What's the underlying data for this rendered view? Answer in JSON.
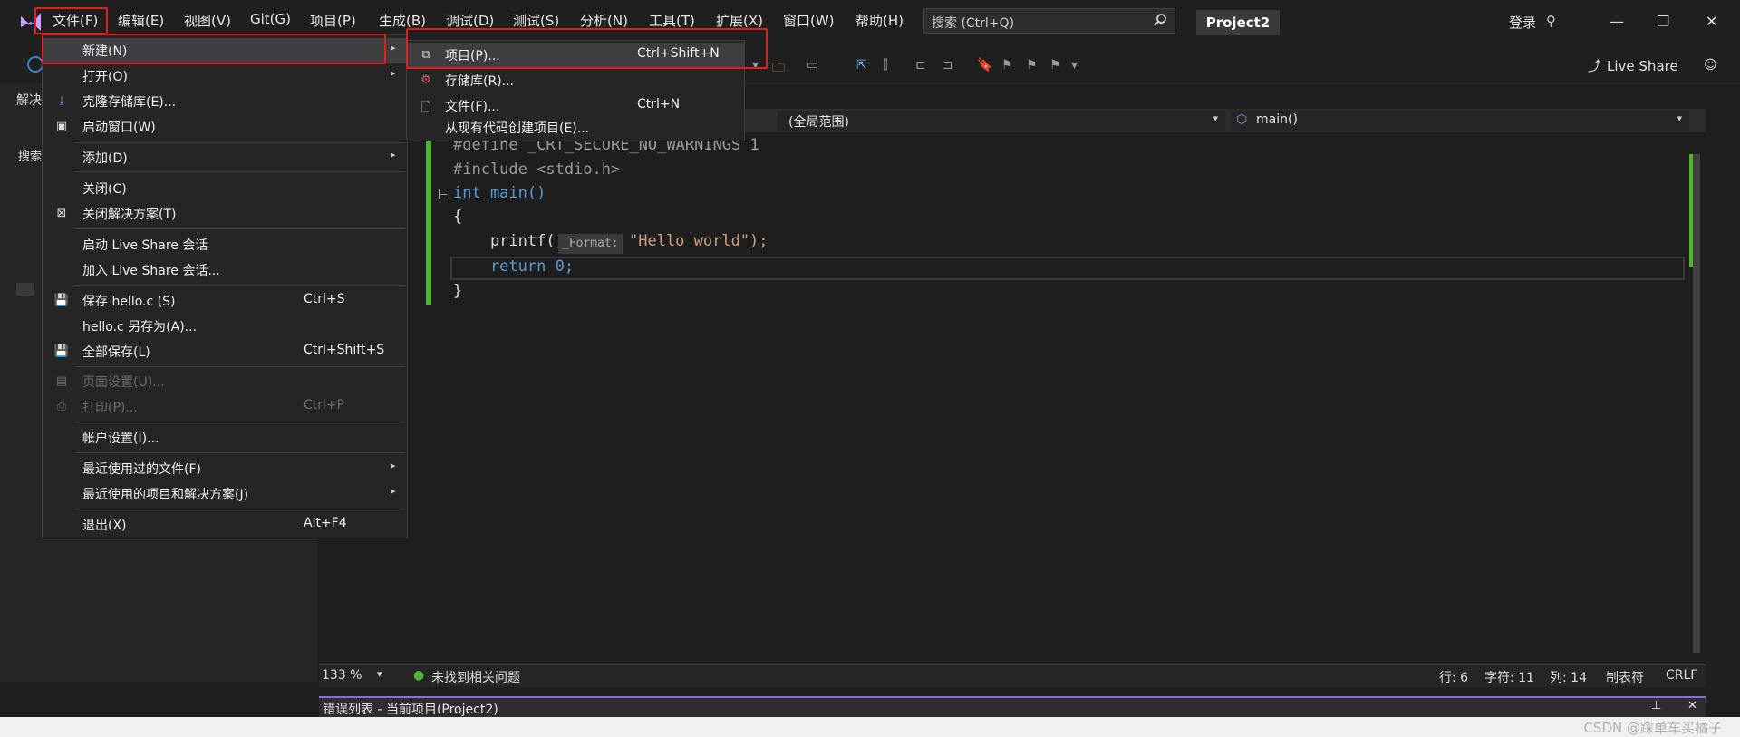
{
  "menubar": {
    "logo": "vs-logo-icon",
    "items": [
      "文件(F)",
      "编辑(E)",
      "视图(V)",
      "Git(G)",
      "项目(P)",
      "生成(B)",
      "调试(D)",
      "测试(S)",
      "分析(N)",
      "工具(T)",
      "扩展(X)",
      "窗口(W)",
      "帮助(H)"
    ],
    "search_placeholder": "搜索 (Ctrl+Q)",
    "project_name": "Project2",
    "signin": "登录",
    "live_share": "Live Share"
  },
  "left_panel": {
    "title": "解决",
    "search": "搜索"
  },
  "file_menu": {
    "items": [
      {
        "label": "新建(N)",
        "shortcut": "",
        "arrow": "▸",
        "icon": "",
        "disabled": false
      },
      {
        "label": "打开(O)",
        "shortcut": "",
        "arrow": "▸",
        "icon": "",
        "disabled": false
      },
      {
        "label": "克隆存储库(E)...",
        "shortcut": "",
        "arrow": "",
        "icon": "clone-icon",
        "disabled": false
      },
      {
        "label": "启动窗口(W)",
        "shortcut": "",
        "arrow": "",
        "icon": "start-window-icon",
        "disabled": false
      },
      {
        "label": "添加(D)",
        "shortcut": "",
        "arrow": "▸",
        "icon": "",
        "disabled": false
      },
      {
        "label": "关闭(C)",
        "shortcut": "",
        "arrow": "",
        "icon": "",
        "disabled": false
      },
      {
        "label": "关闭解决方案(T)",
        "shortcut": "",
        "arrow": "",
        "icon": "close-solution-icon",
        "disabled": false
      },
      {
        "label": "启动 Live Share 会话",
        "shortcut": "",
        "arrow": "",
        "icon": "",
        "disabled": false
      },
      {
        "label": "加入 Live Share 会话...",
        "shortcut": "",
        "arrow": "",
        "icon": "",
        "disabled": false
      },
      {
        "label": "保存 hello.c (S)",
        "shortcut": "Ctrl+S",
        "arrow": "",
        "icon": "save-icon",
        "disabled": false
      },
      {
        "label": "hello.c 另存为(A)...",
        "shortcut": "",
        "arrow": "",
        "icon": "",
        "disabled": false
      },
      {
        "label": "全部保存(L)",
        "shortcut": "Ctrl+Shift+S",
        "arrow": "",
        "icon": "save-all-icon",
        "disabled": false
      },
      {
        "label": "页面设置(U)...",
        "shortcut": "",
        "arrow": "",
        "icon": "page-setup-icon",
        "disabled": true
      },
      {
        "label": "打印(P)...",
        "shortcut": "Ctrl+P",
        "arrow": "",
        "icon": "print-icon",
        "disabled": true
      },
      {
        "label": "帐户设置(I)...",
        "shortcut": "",
        "arrow": "",
        "icon": "",
        "disabled": false
      },
      {
        "label": "最近使用过的文件(F)",
        "shortcut": "",
        "arrow": "▸",
        "icon": "",
        "disabled": false
      },
      {
        "label": "最近使用的项目和解决方案(J)",
        "shortcut": "",
        "arrow": "▸",
        "icon": "",
        "disabled": false
      },
      {
        "label": "退出(X)",
        "shortcut": "Alt+F4",
        "arrow": "",
        "icon": "",
        "disabled": false
      }
    ]
  },
  "new_submenu": {
    "items": [
      {
        "label": "项目(P)...",
        "shortcut": "Ctrl+Shift+N",
        "icon": "new-project-icon"
      },
      {
        "label": "存储库(R)...",
        "shortcut": "",
        "icon": "repository-icon"
      },
      {
        "label": "文件(F)...",
        "shortcut": "Ctrl+N",
        "icon": "new-file-icon"
      },
      {
        "label": "从现有代码创建项目(E)...",
        "shortcut": "",
        "icon": ""
      }
    ]
  },
  "editor": {
    "scope": "(全局范围)",
    "function": "main()",
    "lines": [
      "#define _CRT_SECURE_NO_WARNINGS 1",
      "#include <stdio.h>",
      "int main()",
      "{",
      "    printf(",
      "    return 0;",
      "}"
    ],
    "param_hint": "_Format:",
    "printf_arg": "\"Hello world\");"
  },
  "status": {
    "zoom": "133 %",
    "issues": "未找到相关问题",
    "line": "行: 6",
    "char": "字符: 11",
    "col": "列: 14",
    "tabs": "制表符",
    "eol": "CRLF"
  },
  "error_list": {
    "title": "错误列表 - 当前项目(Project2)"
  },
  "watermark": "CSDN @踩单车买橘子",
  "colors": {
    "highlight": "#e02020",
    "accent": "#8a6fd1",
    "keyword": "#569cd6",
    "string": "#d69d85",
    "macro": "#9b9b9b"
  }
}
